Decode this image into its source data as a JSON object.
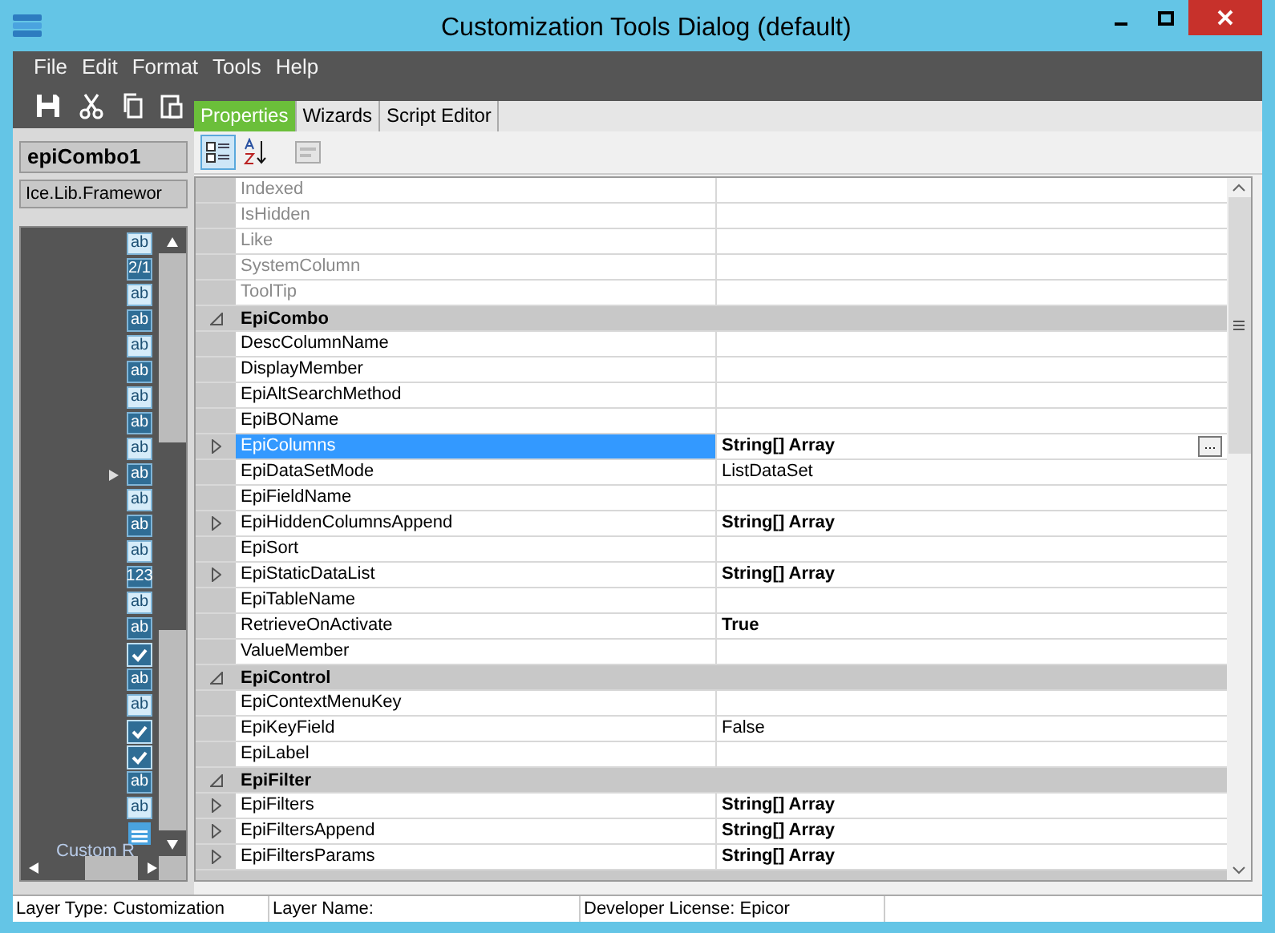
{
  "window": {
    "title": "Customization Tools Dialog (default)"
  },
  "menu": [
    "File",
    "Edit",
    "Format",
    "Tools",
    "Help"
  ],
  "left_panel": {
    "control_name": "epiCombo1",
    "control_type": "Ice.Lib.Framewor",
    "footer": "Custom R",
    "items": [
      {
        "kind": "text",
        "label": "ab",
        "current": false
      },
      {
        "kind": "text",
        "label": "2/1",
        "current": false
      },
      {
        "kind": "text",
        "label": "ab",
        "current": false
      },
      {
        "kind": "text",
        "label": "ab",
        "current": false
      },
      {
        "kind": "text",
        "label": "ab",
        "current": false
      },
      {
        "kind": "text",
        "label": "ab",
        "current": false
      },
      {
        "kind": "text",
        "label": "ab",
        "current": false
      },
      {
        "kind": "text",
        "label": "ab",
        "current": false
      },
      {
        "kind": "text",
        "label": "ab",
        "current": false
      },
      {
        "kind": "text",
        "label": "ab",
        "current": true
      },
      {
        "kind": "text",
        "label": "ab",
        "current": false
      },
      {
        "kind": "text",
        "label": "ab",
        "current": false
      },
      {
        "kind": "text",
        "label": "ab",
        "current": false
      },
      {
        "kind": "text",
        "label": "123",
        "current": false
      },
      {
        "kind": "text",
        "label": "ab",
        "current": false
      },
      {
        "kind": "text",
        "label": "ab",
        "current": false
      },
      {
        "kind": "check",
        "current": false
      },
      {
        "kind": "text",
        "label": "ab",
        "current": false
      },
      {
        "kind": "text",
        "label": "ab",
        "current": false
      },
      {
        "kind": "check",
        "current": false
      },
      {
        "kind": "check",
        "current": false
      },
      {
        "kind": "text",
        "label": "ab",
        "current": false
      },
      {
        "kind": "text",
        "label": "ab",
        "current": false
      },
      {
        "kind": "form",
        "current": false
      }
    ]
  },
  "tabs": [
    {
      "label": "Properties",
      "selected": true
    },
    {
      "label": "Wizards",
      "selected": false
    },
    {
      "label": "Script Editor",
      "selected": false
    }
  ],
  "grid_toolbar": [
    {
      "kind": "categorized",
      "selected": true
    },
    {
      "kind": "alphabetical",
      "selected": false
    },
    {
      "kind": "pages",
      "selected": false
    }
  ],
  "properties": [
    {
      "kind": "property",
      "name": "Indexed",
      "disabled": true
    },
    {
      "kind": "property",
      "name": "IsHidden",
      "disabled": true
    },
    {
      "kind": "property",
      "name": "Like",
      "disabled": true
    },
    {
      "kind": "property",
      "name": "SystemColumn",
      "disabled": true
    },
    {
      "kind": "property",
      "name": "ToolTip",
      "disabled": true
    },
    {
      "kind": "category",
      "name": "EpiCombo",
      "expanded": true
    },
    {
      "kind": "property",
      "name": "DescColumnName",
      "disabled": false
    },
    {
      "kind": "property",
      "name": "DisplayMember",
      "disabled": false
    },
    {
      "kind": "property",
      "name": "EpiAltSearchMethod",
      "disabled": false
    },
    {
      "kind": "property",
      "name": "EpiBOName",
      "disabled": false
    },
    {
      "kind": "property",
      "name": "EpiColumns",
      "value": "String[] Array",
      "bold": true,
      "expandable": true,
      "selected": true,
      "disabled": false,
      "button": "..."
    },
    {
      "kind": "property",
      "name": "EpiDataSetMode",
      "value": "ListDataSet",
      "disabled": false
    },
    {
      "kind": "property",
      "name": "EpiFieldName",
      "disabled": false
    },
    {
      "kind": "property",
      "name": "EpiHiddenColumnsAppend",
      "value": "String[] Array",
      "bold": true,
      "expandable": true,
      "disabled": false
    },
    {
      "kind": "property",
      "name": "EpiSort",
      "disabled": false
    },
    {
      "kind": "property",
      "name": "EpiStaticDataList",
      "value": "String[] Array",
      "bold": true,
      "expandable": true,
      "disabled": false
    },
    {
      "kind": "property",
      "name": "EpiTableName",
      "disabled": false
    },
    {
      "kind": "property",
      "name": "RetrieveOnActivate",
      "value": "True",
      "bold": true,
      "disabled": false
    },
    {
      "kind": "property",
      "name": "ValueMember",
      "disabled": false
    },
    {
      "kind": "category",
      "name": "EpiControl",
      "expanded": true
    },
    {
      "kind": "property",
      "name": "EpiContextMenuKey",
      "disabled": false
    },
    {
      "kind": "property",
      "name": "EpiKeyField",
      "value": "False",
      "disabled": false
    },
    {
      "kind": "property",
      "name": "EpiLabel",
      "disabled": false
    },
    {
      "kind": "category",
      "name": "EpiFilter",
      "expanded": true
    },
    {
      "kind": "property",
      "name": "EpiFilters",
      "value": "String[] Array",
      "bold": true,
      "expandable": true,
      "disabled": false
    },
    {
      "kind": "property",
      "name": "EpiFiltersAppend",
      "value": "String[] Array",
      "bold": true,
      "expandable": true,
      "disabled": false
    },
    {
      "kind": "property",
      "name": "EpiFiltersParams",
      "value": "String[] Array",
      "bold": true,
      "expandable": true,
      "disabled": false
    }
  ],
  "status_bar": [
    {
      "label": "Layer Type:",
      "value": "Customization"
    },
    {
      "label": "Layer Name:"
    },
    {
      "label": "Developer License:",
      "value": "Epicor"
    }
  ]
}
